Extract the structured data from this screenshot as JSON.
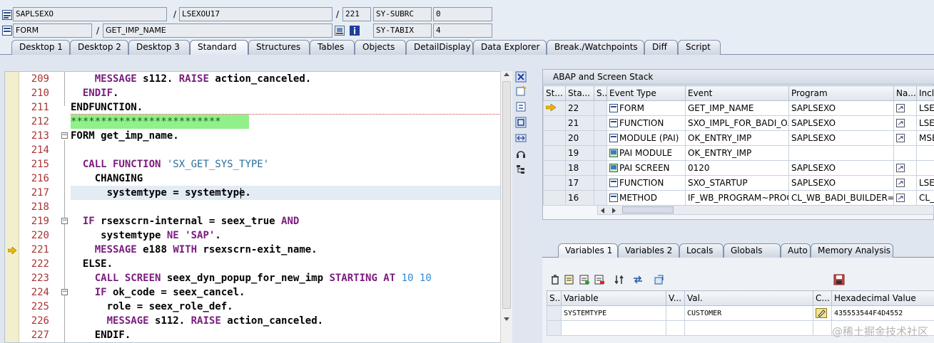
{
  "header": {
    "program_name": "SAPLSEXO",
    "include_name": "LSEXOU17",
    "line_no": "221",
    "subrc_label": "SY-SUBRC",
    "subrc_value": "0",
    "block_type": "FORM",
    "block_name": "GET_IMP_NAME",
    "tabix_label": "SY-TABIX",
    "tabix_value": "4",
    "sep1": "/",
    "sep2": "/",
    "sep3": "/",
    "sep4": "/"
  },
  "tabs": [
    "Desktop 1",
    "Desktop 2",
    "Desktop 3",
    "Standard",
    "Structures",
    "Tables",
    "Objects",
    "DetailDisplay",
    "Data Explorer",
    "Break./Watchpoints",
    "Diff",
    "Script"
  ],
  "active_tab": "Standard",
  "code": {
    "lines": [
      {
        "n": "209",
        "t": "    MESSAGE s112. RAISE action_canceled."
      },
      {
        "n": "210",
        "t": "  ENDIF."
      },
      {
        "n": "211",
        "t": "ENDFUNCTION."
      },
      {
        "n": "212",
        "t": "*************************"
      },
      {
        "n": "213",
        "t": "FORM get_imp_name."
      },
      {
        "n": "214",
        "t": ""
      },
      {
        "n": "215",
        "t": "  CALL FUNCTION 'SX_GET_SYS_TYPE'"
      },
      {
        "n": "216",
        "t": "    CHANGING"
      },
      {
        "n": "217",
        "t": "      systemtype = systemtype."
      },
      {
        "n": "218",
        "t": ""
      },
      {
        "n": "219",
        "t": "  IF rsexscrn-internal = seex_true AND"
      },
      {
        "n": "220",
        "t": "     systemtype NE 'SAP'."
      },
      {
        "n": "221",
        "t": "    MESSAGE e188 WITH rsexscrn-exit_name."
      },
      {
        "n": "222",
        "t": "  ELSE."
      },
      {
        "n": "223",
        "t": "    CALL SCREEN seex_dyn_popup_for_new_imp STARTING AT 10 10"
      },
      {
        "n": "224",
        "t": "    IF ok_code = seex_cancel."
      },
      {
        "n": "225",
        "t": "      role = seex_role_def."
      },
      {
        "n": "226",
        "t": "      MESSAGE s112. RAISE action_canceled."
      },
      {
        "n": "227",
        "t": "    ENDIF."
      }
    ]
  },
  "stack": {
    "title": "ABAP and Screen Stack",
    "columns": [
      "St...",
      "Sta...",
      "S...",
      "Event Type",
      "Event",
      "Program",
      "Na...",
      "Inclu"
    ],
    "rows": [
      {
        "sta": "22",
        "type": "FORM",
        "event": "GET_IMP_NAME",
        "program": "SAPLSEXO",
        "incl": "LSEX"
      },
      {
        "sta": "21",
        "type": "FUNCTION",
        "event": "SXO_IMPL_FOR_BADI_O...",
        "program": "SAPLSEXO",
        "incl": "LSEX"
      },
      {
        "sta": "20",
        "type": "MODULE (PAI)",
        "event": "OK_ENTRY_IMP",
        "program": "SAPLSEXO",
        "incl": "MSE"
      },
      {
        "sta": "19",
        "type": "PAI MODULE",
        "event": "OK_ENTRY_IMP",
        "program": "",
        "incl": ""
      },
      {
        "sta": "18",
        "type": "PAI SCREEN",
        "event": "0120",
        "program": "SAPLSEXO",
        "incl": ""
      },
      {
        "sta": "17",
        "type": "FUNCTION",
        "event": "SXO_STARTUP",
        "program": "SAPLSEXO",
        "incl": "LSEX"
      },
      {
        "sta": "16",
        "type": "METHOD",
        "event": "IF_WB_PROGRAM~PROC...",
        "program": "CL_WB_BADI_BUILDER=...",
        "incl": "CL_W"
      }
    ]
  },
  "var_tabs": [
    "Variables 1",
    "Variables 2",
    "Locals",
    "Globals",
    "Auto",
    "Memory Analysis"
  ],
  "active_var_tab": "Variables 1",
  "variables": {
    "columns": [
      "S...",
      "Variable",
      "V...",
      "Val.",
      "C...",
      "Hexadecimal Value"
    ],
    "rows": [
      {
        "variable": "SYSTEMTYPE",
        "value": "CUSTOMER",
        "hex": "435553544F4D4552"
      }
    ]
  },
  "watermark": "@稀土掘金技术社区"
}
